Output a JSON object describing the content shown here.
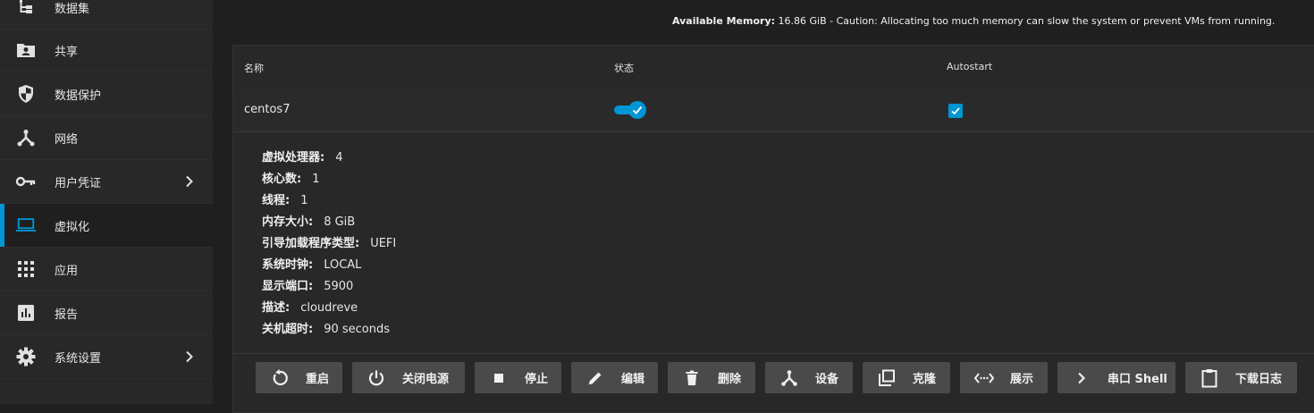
{
  "sidebar": {
    "items": [
      {
        "label": "数据集",
        "icon": "dataset-icon"
      },
      {
        "label": "共享",
        "icon": "share-icon"
      },
      {
        "label": "数据保护",
        "icon": "shield-icon"
      },
      {
        "label": "网络",
        "icon": "network-icon"
      },
      {
        "label": "用户凭证",
        "icon": "key-icon",
        "has_submenu": true
      },
      {
        "label": "虚拟化",
        "icon": "laptop-icon",
        "active": true
      },
      {
        "label": "应用",
        "icon": "apps-grid-icon"
      },
      {
        "label": "报告",
        "icon": "report-chart-icon"
      },
      {
        "label": "系统设置",
        "icon": "gear-icon",
        "has_submenu": true
      }
    ]
  },
  "memory": {
    "label": "Available Memory:",
    "text": " 16.86 GiB - Caution: Allocating too much memory can slow the system or prevent VMs from running."
  },
  "table": {
    "headers": {
      "name": "名称",
      "state": "状态",
      "autostart": "Autostart"
    },
    "row": {
      "name": "centos7",
      "state_on": true,
      "autostart": true
    }
  },
  "details": [
    {
      "key": "虚拟处理器:",
      "value": "4"
    },
    {
      "key": "核心数:",
      "value": "1"
    },
    {
      "key": "线程:",
      "value": "1"
    },
    {
      "key": "内存大小:",
      "value": "8 GiB"
    },
    {
      "key": "引导加载程序类型:",
      "value": "UEFI"
    },
    {
      "key": "系统时钟:",
      "value": "LOCAL"
    },
    {
      "key": "显示端口:",
      "value": "5900"
    },
    {
      "key": "描述:",
      "value": "cloudreve"
    },
    {
      "key": "关机超时:",
      "value": "90 seconds"
    }
  ],
  "actions": [
    {
      "label": "重启",
      "icon": "restart-icon"
    },
    {
      "label": "关闭电源",
      "icon": "power-icon"
    },
    {
      "label": "停止",
      "icon": "stop-icon"
    },
    {
      "label": "编辑",
      "icon": "edit-icon"
    },
    {
      "label": "删除",
      "icon": "delete-icon"
    },
    {
      "label": "设备",
      "icon": "devices-icon"
    },
    {
      "label": "克隆",
      "icon": "clone-icon"
    },
    {
      "label": "展示",
      "icon": "display-icon"
    },
    {
      "label": "串口 Shell",
      "icon": "serial-shell-icon"
    },
    {
      "label": "下载日志",
      "icon": "download-log-icon"
    }
  ],
  "colors": {
    "accent": "#0095d5",
    "button_bg": "#4a4a4a"
  }
}
